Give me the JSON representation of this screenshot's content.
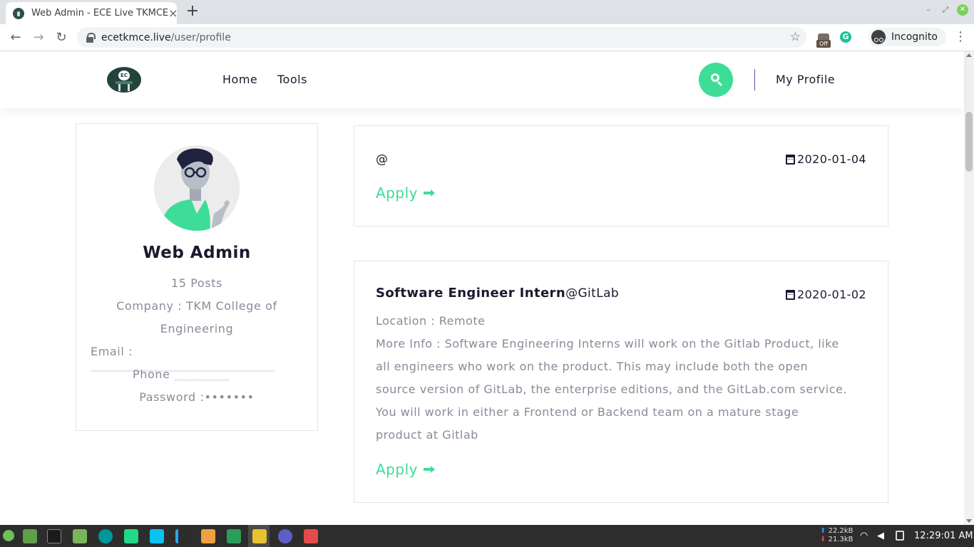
{
  "browser": {
    "tab_title": "Web Admin - ECE Live TKMCE",
    "tab_close": "×",
    "new_tab": "+",
    "url_host": "ecetkmce.live",
    "url_path": "/user/profile",
    "incognito_label": "Incognito",
    "ext_off_label": "Off",
    "ext_g_label": "G"
  },
  "header": {
    "logo_text": "EC",
    "nav": [
      "Home",
      "Tools"
    ],
    "my_profile": "My Profile"
  },
  "profile": {
    "name": "Web Admin",
    "posts": "15 Posts",
    "company_line1": "Company : TKM College of",
    "company_line2": "Engineering",
    "email_label": "Email : ",
    "phone_label": "Phone",
    "password": "Password :•••••••"
  },
  "jobs": [
    {
      "title": "",
      "company": "@",
      "date": "2020-01-04",
      "apply_label": "Apply"
    },
    {
      "title": "Software Engineer Intern",
      "company": "@GitLab",
      "date": "2020-01-02",
      "location": "Location : Remote",
      "info_lines": [
        "More Info : Software Engineering Interns will work on the Gitlab Product, like",
        "all engineers who work on the product. This may include both the open",
        "source version of GitLab, the enterprise editions, and the GitLab.com service.",
        "You will work in either a Frontend or Backend team on a mature stage",
        "product at Gitlab"
      ],
      "apply_label": "Apply"
    }
  ],
  "taskbar": {
    "net_up": "22.2kB",
    "net_down": "21.3kB",
    "clock": "12:29:01 AM"
  },
  "colors": {
    "accent": "#3ddc97",
    "heading": "#1a1a2e",
    "muted": "#8a8a9a",
    "divider": "#5c52b8"
  }
}
